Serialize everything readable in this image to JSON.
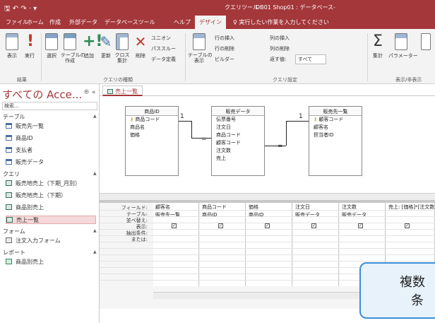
{
  "titlebar": {
    "quick_access": "🖫 ↶ ↷ · ▾",
    "context_label": "クエリツール",
    "doc_title": "DB01 Shop01 : データベース-"
  },
  "menu": {
    "tabs": [
      "ファイル",
      "ホーム",
      "作成",
      "外部データ",
      "データベースツール",
      "ヘルプ",
      "デザイン"
    ],
    "active_index": 6,
    "tell_me": "♀ 実行したい作業を入力してください"
  },
  "ribbon": {
    "groups": {
      "results": "結果",
      "query_type": "クエリの種類",
      "query_setup": "クエリ設定",
      "show_hide": "表示/非表示"
    },
    "buttons": {
      "view": "表示",
      "run": "実行",
      "select": "選択",
      "make_table": "テーブルの\n作成",
      "append": "追加",
      "update": "更新",
      "crosstab": "クロス\n集計",
      "delete": "削除",
      "show_table": "テーブルの\n表示",
      "totals": "集計",
      "parameters": "パラメーター"
    },
    "small": {
      "union": "ユニオン",
      "pass_through": "パススルー",
      "data_definition": "データ定義",
      "insert_rows": "行の挿入",
      "delete_rows": "行の削除",
      "builder": "ビルダー",
      "insert_columns": "列の挿入",
      "delete_columns": "列の削除",
      "return": "返す値:",
      "return_value": "すべて"
    }
  },
  "nav": {
    "header": "すべての Acce...",
    "header_btn": "® «",
    "search": "検索...",
    "categories": {
      "tables": "テーブル",
      "queries": "クエリ",
      "forms": "フォーム",
      "reports": "レポート"
    },
    "tables": [
      "販売先一覧",
      "商品ID",
      "支払者",
      "販売データ"
    ],
    "queries": [
      "販売地売上（下期_月別）",
      "販売地売上（下期）",
      "商品別売上",
      "売上一覧"
    ],
    "forms": [
      "注文入力フォーム"
    ],
    "reports": [
      "商品別売上"
    ],
    "selected_query_index": 3
  },
  "tab": {
    "label": "売上一覧"
  },
  "diagram": {
    "tables": [
      {
        "title": "商品ID",
        "fields": [
          "商品コード",
          "商品名",
          "価格"
        ],
        "key_field": 0
      },
      {
        "title": "販売データ",
        "fields": [
          "伝票番号",
          "注文日",
          "商品コード",
          "顧客コード",
          "注文数",
          "売上"
        ],
        "key_field": -1
      },
      {
        "title": "販売先一覧",
        "fields": [
          "顧客コード",
          "顧客名",
          "担当者ID"
        ],
        "key_field": 0
      }
    ]
  },
  "grid": {
    "row_labels": [
      "フィールド:",
      "テーブル:",
      "並べ替え:",
      "表示:",
      "抽出条件:",
      "または:"
    ],
    "columns": [
      {
        "field": "顧客名",
        "table": "販売先一覧",
        "show": true
      },
      {
        "field": "商品コード",
        "table": "商品ID",
        "show": true
      },
      {
        "field": "価格",
        "table": "商品ID",
        "show": true
      },
      {
        "field": "注文日",
        "table": "販売データ",
        "show": true
      },
      {
        "field": "注文数",
        "table": "販売データ",
        "show": true
      },
      {
        "field": "売上: [価格]*[注文数]",
        "table": "",
        "show": true
      }
    ]
  },
  "callout": {
    "line1": "複数",
    "line2": "条"
  },
  "colors": {
    "accent": "#a4373a",
    "callout_border": "#3b8ed8",
    "callout_fill": "#e7f2fb"
  }
}
